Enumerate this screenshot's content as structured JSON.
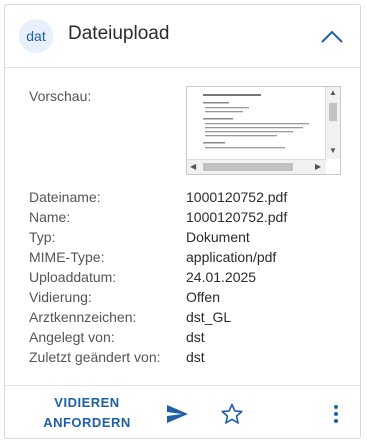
{
  "header": {
    "avatar_text": "dat",
    "title": "Dateiupload",
    "collapse_icon": "chevron-up-icon"
  },
  "preview": {
    "label": "Vorschau:"
  },
  "metadata": [
    {
      "label": "Dateiname:",
      "value": "1000120752.pdf"
    },
    {
      "label": "Name:",
      "value": "1000120752.pdf"
    },
    {
      "label": "Typ:",
      "value": "Dokument"
    },
    {
      "label": "MIME-Type:",
      "value": "application/pdf"
    },
    {
      "label": "Uploaddatum:",
      "value": "24.01.2025"
    },
    {
      "label": "Vidierung:",
      "value": "Offen"
    },
    {
      "label": "Arztkennzeichen:",
      "value": "dst_GL"
    },
    {
      "label": "Angelegt von:",
      "value": "dst"
    },
    {
      "label": "Zuletzt geändert von:",
      "value": "dst"
    }
  ],
  "footer": {
    "vidieren_line1": "VIDIEREN",
    "vidieren_line2": "ANFORDERN",
    "send_icon": "send-icon",
    "star_icon": "star-icon",
    "more_icon": "more-vertical-icon"
  },
  "colors": {
    "accent": "#1f5fa8",
    "avatar_bg": "#e8f0fb",
    "border": "#d8d8d8"
  }
}
